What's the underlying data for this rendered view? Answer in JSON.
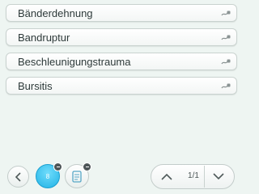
{
  "list": {
    "items": [
      {
        "label": "Bänderdehnung",
        "icon": "cable-plug-icon"
      },
      {
        "label": "Bandruptur",
        "icon": "cable-plug-icon"
      },
      {
        "label": "Beschleunigungstrauma",
        "icon": "cable-plug-icon"
      },
      {
        "label": "Bursitis",
        "icon": "cable-plug-icon"
      }
    ]
  },
  "toolbar": {
    "badge_value": "8",
    "pager_text": "1/1"
  },
  "colors": {
    "background": "#eef5f2",
    "accent_blue": "#22b3e6",
    "badge_dark": "#4d5557"
  }
}
